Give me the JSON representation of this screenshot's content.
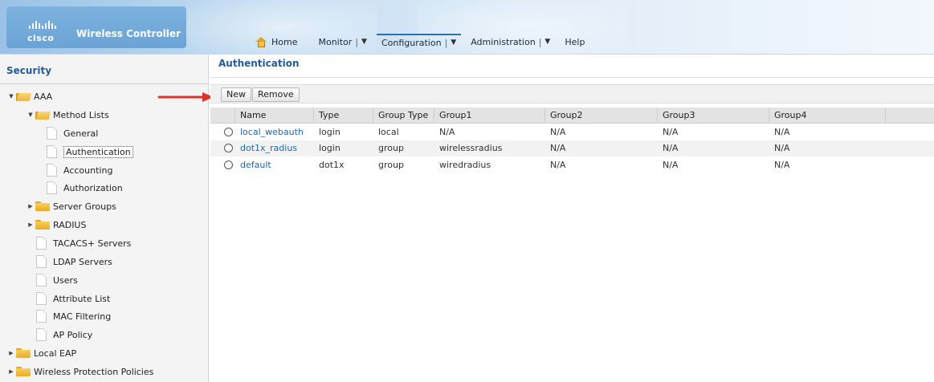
{
  "brand": {
    "company": "cisco",
    "product": "Wireless Controller"
  },
  "nav": {
    "items": [
      {
        "label": "Home",
        "icon": "home-icon",
        "active": false,
        "dropdown": false
      },
      {
        "label": "Monitor",
        "active": false,
        "dropdown": true
      },
      {
        "label": "Configuration",
        "active": true,
        "dropdown": true
      },
      {
        "label": "Administration",
        "active": false,
        "dropdown": true
      },
      {
        "label": "Help",
        "active": false,
        "dropdown": false
      }
    ]
  },
  "sidebar": {
    "title": "Security",
    "tree": {
      "aaa": "AAA",
      "method_lists": "Method Lists",
      "general": "General",
      "authentication": "Authentication",
      "accounting": "Accounting",
      "authorization": "Authorization",
      "server_groups": "Server Groups",
      "radius": "RADIUS",
      "tacacs": "TACACS+ Servers",
      "ldap": "LDAP Servers",
      "users": "Users",
      "attribute_list": "Attribute List",
      "mac_filtering": "MAC Filtering",
      "ap_policy": "AP Policy",
      "local_eap": "Local EAP",
      "wireless_protection": "Wireless Protection Policies"
    }
  },
  "main": {
    "title": "Authentication",
    "toolbar": {
      "new_label": "New",
      "remove_label": "Remove"
    },
    "table": {
      "columns": [
        "Name",
        "Type",
        "Group Type",
        "Group1",
        "Group2",
        "Group3",
        "Group4"
      ],
      "rows": [
        {
          "name": "local_webauth",
          "type": "login",
          "group_type": "local",
          "group1": "N/A",
          "group2": "N/A",
          "group3": "N/A",
          "group4": "N/A"
        },
        {
          "name": "dot1x_radius",
          "type": "login",
          "group_type": "group",
          "group1": "wirelessradius",
          "group2": "N/A",
          "group3": "N/A",
          "group4": "N/A"
        },
        {
          "name": "default",
          "type": "dot1x",
          "group_type": "group",
          "group1": "wiredradius",
          "group2": "N/A",
          "group3": "N/A",
          "group4": "N/A"
        }
      ]
    }
  },
  "colors": {
    "accent_blue": "#245ba0",
    "link_blue": "#1f64b5",
    "annotation_red": "#d9352b"
  }
}
